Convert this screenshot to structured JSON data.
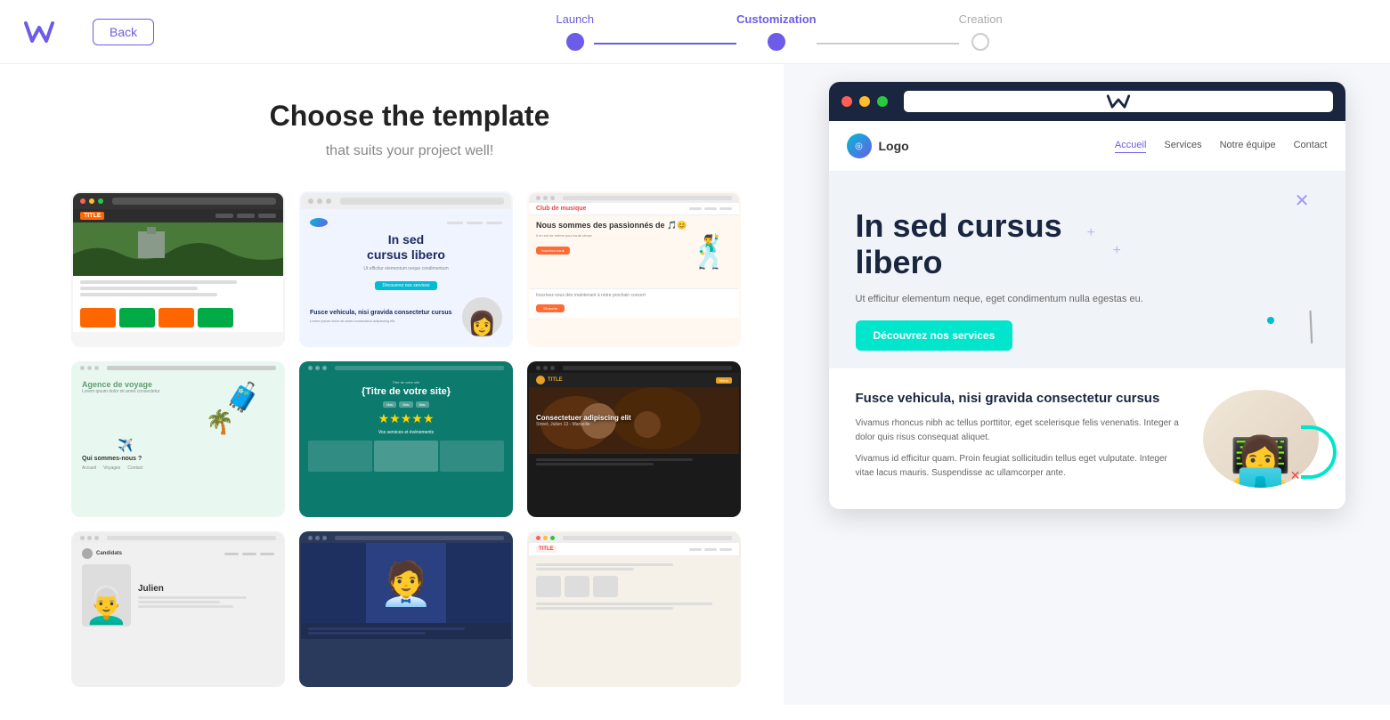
{
  "header": {
    "back_label": "Back",
    "logo_alt": "W logo"
  },
  "stepper": {
    "steps": [
      {
        "label": "Launch",
        "state": "completed"
      },
      {
        "label": "Customization",
        "state": "active"
      },
      {
        "label": "Creation",
        "state": "inactive"
      }
    ]
  },
  "main_panel": {
    "title": "Choose the template",
    "subtitle": "that suits your project well!",
    "templates": [
      {
        "id": 1,
        "name": "Castle/Nature template",
        "type": "dark-landscape"
      },
      {
        "id": 2,
        "name": "Blue cursus template",
        "type": "blue-minimal",
        "heading": "In sed cursus libero"
      },
      {
        "id": 3,
        "name": "Music club template",
        "type": "music-orange"
      },
      {
        "id": 4,
        "name": "Travel agency template",
        "type": "travel-green"
      },
      {
        "id": 5,
        "name": "Events template",
        "type": "teal-events"
      },
      {
        "id": 6,
        "name": "Restaurant template",
        "type": "dark-food"
      },
      {
        "id": 7,
        "name": "Julien template",
        "type": "portrait-gray"
      },
      {
        "id": 8,
        "name": "Blue portrait template",
        "type": "blue-portrait"
      },
      {
        "id": 9,
        "name": "Classic template",
        "type": "classic-icons"
      }
    ]
  },
  "preview": {
    "url_bar_logo": "W",
    "site": {
      "logo_text": "Logo",
      "nav_links": [
        "Accueil",
        "Services",
        "Notre équipe",
        "Contact"
      ],
      "hero_heading": "In sed cursus libero",
      "hero_subtext": "Ut efficitur elementum neque, eget condimentum nulla egestas eu.",
      "hero_cta": "Découvrez nos services",
      "lower_title": "Fusce vehicula, nisi gravida consectetur cursus",
      "lower_para1": "Vivamus rhoncus nibh ac tellus porttitor, eget scelerisque felis venenatis. Integer a dolor quis risus consequat aliquet.",
      "lower_para2": "Vivamus id efficitur quam. Proin feugiat sollicitudin tellus eget vulputate. Integer vitae lacus mauris. Suspendisse ac ullamcorper ante."
    }
  }
}
